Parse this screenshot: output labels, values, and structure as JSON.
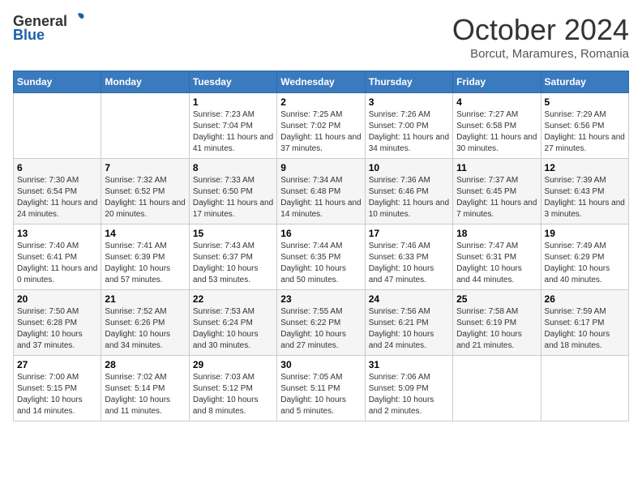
{
  "logo": {
    "general": "General",
    "blue": "Blue"
  },
  "title": "October 2024",
  "location": "Borcut, Maramures, Romania",
  "days_of_week": [
    "Sunday",
    "Monday",
    "Tuesday",
    "Wednesday",
    "Thursday",
    "Friday",
    "Saturday"
  ],
  "weeks": [
    [
      {
        "day": "",
        "content": ""
      },
      {
        "day": "",
        "content": ""
      },
      {
        "day": "1",
        "content": "Sunrise: 7:23 AM\nSunset: 7:04 PM\nDaylight: 11 hours and 41 minutes."
      },
      {
        "day": "2",
        "content": "Sunrise: 7:25 AM\nSunset: 7:02 PM\nDaylight: 11 hours and 37 minutes."
      },
      {
        "day": "3",
        "content": "Sunrise: 7:26 AM\nSunset: 7:00 PM\nDaylight: 11 hours and 34 minutes."
      },
      {
        "day": "4",
        "content": "Sunrise: 7:27 AM\nSunset: 6:58 PM\nDaylight: 11 hours and 30 minutes."
      },
      {
        "day": "5",
        "content": "Sunrise: 7:29 AM\nSunset: 6:56 PM\nDaylight: 11 hours and 27 minutes."
      }
    ],
    [
      {
        "day": "6",
        "content": "Sunrise: 7:30 AM\nSunset: 6:54 PM\nDaylight: 11 hours and 24 minutes."
      },
      {
        "day": "7",
        "content": "Sunrise: 7:32 AM\nSunset: 6:52 PM\nDaylight: 11 hours and 20 minutes."
      },
      {
        "day": "8",
        "content": "Sunrise: 7:33 AM\nSunset: 6:50 PM\nDaylight: 11 hours and 17 minutes."
      },
      {
        "day": "9",
        "content": "Sunrise: 7:34 AM\nSunset: 6:48 PM\nDaylight: 11 hours and 14 minutes."
      },
      {
        "day": "10",
        "content": "Sunrise: 7:36 AM\nSunset: 6:46 PM\nDaylight: 11 hours and 10 minutes."
      },
      {
        "day": "11",
        "content": "Sunrise: 7:37 AM\nSunset: 6:45 PM\nDaylight: 11 hours and 7 minutes."
      },
      {
        "day": "12",
        "content": "Sunrise: 7:39 AM\nSunset: 6:43 PM\nDaylight: 11 hours and 3 minutes."
      }
    ],
    [
      {
        "day": "13",
        "content": "Sunrise: 7:40 AM\nSunset: 6:41 PM\nDaylight: 11 hours and 0 minutes."
      },
      {
        "day": "14",
        "content": "Sunrise: 7:41 AM\nSunset: 6:39 PM\nDaylight: 10 hours and 57 minutes."
      },
      {
        "day": "15",
        "content": "Sunrise: 7:43 AM\nSunset: 6:37 PM\nDaylight: 10 hours and 53 minutes."
      },
      {
        "day": "16",
        "content": "Sunrise: 7:44 AM\nSunset: 6:35 PM\nDaylight: 10 hours and 50 minutes."
      },
      {
        "day": "17",
        "content": "Sunrise: 7:46 AM\nSunset: 6:33 PM\nDaylight: 10 hours and 47 minutes."
      },
      {
        "day": "18",
        "content": "Sunrise: 7:47 AM\nSunset: 6:31 PM\nDaylight: 10 hours and 44 minutes."
      },
      {
        "day": "19",
        "content": "Sunrise: 7:49 AM\nSunset: 6:29 PM\nDaylight: 10 hours and 40 minutes."
      }
    ],
    [
      {
        "day": "20",
        "content": "Sunrise: 7:50 AM\nSunset: 6:28 PM\nDaylight: 10 hours and 37 minutes."
      },
      {
        "day": "21",
        "content": "Sunrise: 7:52 AM\nSunset: 6:26 PM\nDaylight: 10 hours and 34 minutes."
      },
      {
        "day": "22",
        "content": "Sunrise: 7:53 AM\nSunset: 6:24 PM\nDaylight: 10 hours and 30 minutes."
      },
      {
        "day": "23",
        "content": "Sunrise: 7:55 AM\nSunset: 6:22 PM\nDaylight: 10 hours and 27 minutes."
      },
      {
        "day": "24",
        "content": "Sunrise: 7:56 AM\nSunset: 6:21 PM\nDaylight: 10 hours and 24 minutes."
      },
      {
        "day": "25",
        "content": "Sunrise: 7:58 AM\nSunset: 6:19 PM\nDaylight: 10 hours and 21 minutes."
      },
      {
        "day": "26",
        "content": "Sunrise: 7:59 AM\nSunset: 6:17 PM\nDaylight: 10 hours and 18 minutes."
      }
    ],
    [
      {
        "day": "27",
        "content": "Sunrise: 7:00 AM\nSunset: 5:15 PM\nDaylight: 10 hours and 14 minutes."
      },
      {
        "day": "28",
        "content": "Sunrise: 7:02 AM\nSunset: 5:14 PM\nDaylight: 10 hours and 11 minutes."
      },
      {
        "day": "29",
        "content": "Sunrise: 7:03 AM\nSunset: 5:12 PM\nDaylight: 10 hours and 8 minutes."
      },
      {
        "day": "30",
        "content": "Sunrise: 7:05 AM\nSunset: 5:11 PM\nDaylight: 10 hours and 5 minutes."
      },
      {
        "day": "31",
        "content": "Sunrise: 7:06 AM\nSunset: 5:09 PM\nDaylight: 10 hours and 2 minutes."
      },
      {
        "day": "",
        "content": ""
      },
      {
        "day": "",
        "content": ""
      }
    ]
  ]
}
